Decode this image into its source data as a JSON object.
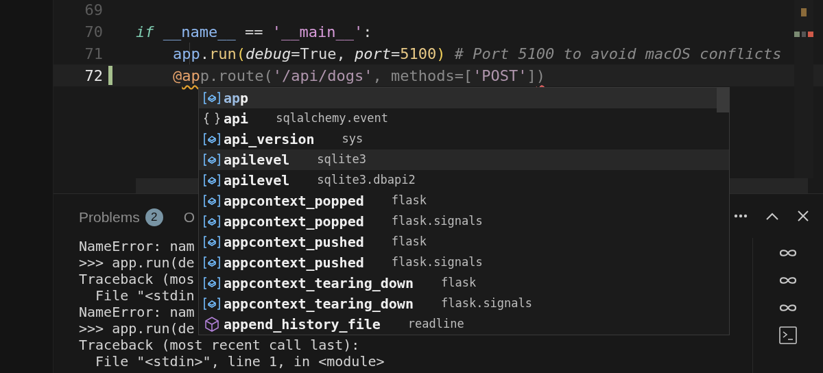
{
  "editor": {
    "lines": [
      {
        "number": "69",
        "current": false,
        "modified": false
      },
      {
        "number": "70",
        "current": false,
        "modified": false,
        "tokens": [
          {
            "text": "if ",
            "kind": "keyword"
          },
          {
            "text": "__name__",
            "kind": "variable"
          },
          {
            "text": " == ",
            "kind": "plain"
          },
          {
            "text": "'__main__'",
            "kind": "string"
          },
          {
            "text": ":",
            "kind": "plain"
          }
        ],
        "children": [
          {
            "number": "71",
            "current": false,
            "modified": false,
            "tokens": [
              {
                "text": "app",
                "kind": "variable"
              },
              {
                "text": ".",
                "kind": "plain"
              },
              {
                "text": "run",
                "kind": "function"
              },
              {
                "text": "(",
                "kind": "bracket"
              },
              {
                "text": "debug",
                "kind": "param"
              },
              {
                "text": "=True, ",
                "kind": "plain"
              },
              {
                "text": "port",
                "kind": "param"
              },
              {
                "text": "=",
                "kind": "plain"
              },
              {
                "text": "5100",
                "kind": "number"
              },
              {
                "text": ")",
                "kind": "bracket"
              },
              {
                "text": " # Port 5100 to avoid macOS conflicts",
                "kind": "comment"
              }
            ]
          },
          {
            "number": "72",
            "current": true,
            "modified": true,
            "tokens": [
              {
                "text": "@",
                "kind": "decorator"
              },
              {
                "text": "ap",
                "kind": "decorator",
                "warning": true
              },
              {
                "text": "p.route(",
                "kind": "ghost"
              },
              {
                "text": "'/api/dogs'",
                "kind": "ghost-string"
              },
              {
                "text": ", methods=[",
                "kind": "ghost"
              },
              {
                "text": "'POST'",
                "kind": "ghost-string"
              },
              {
                "text": "]",
                "kind": "ghost"
              },
              {
                "text": ")",
                "kind": "ghost",
                "error": true
              }
            ]
          }
        ]
      }
    ]
  },
  "suggestions": [
    {
      "match": "ap",
      "rest": "p",
      "kind": "variable",
      "selected": true,
      "hovered": false
    },
    {
      "match": "ap",
      "rest": "i",
      "detail": "sqlalchemy.event",
      "kind": "module",
      "selected": false,
      "hovered": false
    },
    {
      "match": "ap",
      "rest": "i_version",
      "detail": "sys",
      "kind": "variable",
      "selected": false,
      "hovered": false
    },
    {
      "match": "ap",
      "rest": "ilevel",
      "detail": "sqlite3",
      "kind": "variable",
      "selected": false,
      "hovered": true
    },
    {
      "match": "ap",
      "rest": "ilevel",
      "detail": "sqlite3.dbapi2",
      "kind": "variable",
      "selected": false,
      "hovered": false
    },
    {
      "match": "ap",
      "rest": "pcontext_popped",
      "detail": "flask",
      "kind": "variable",
      "selected": false,
      "hovered": false
    },
    {
      "match": "ap",
      "rest": "pcontext_popped",
      "detail": "flask.signals",
      "kind": "variable",
      "selected": false,
      "hovered": false
    },
    {
      "match": "ap",
      "rest": "pcontext_pushed",
      "detail": "flask",
      "kind": "variable",
      "selected": false,
      "hovered": false
    },
    {
      "match": "ap",
      "rest": "pcontext_pushed",
      "detail": "flask.signals",
      "kind": "variable",
      "selected": false,
      "hovered": false
    },
    {
      "match": "ap",
      "rest": "pcontext_tearing_down",
      "detail": "flask",
      "kind": "variable",
      "selected": false,
      "hovered": false
    },
    {
      "match": "ap",
      "rest": "pcontext_tearing_down",
      "detail": "flask.signals",
      "kind": "variable",
      "selected": false,
      "hovered": false
    },
    {
      "match": "ap",
      "rest": "pend_history_file",
      "detail": "readline",
      "kind": "class",
      "selected": false,
      "hovered": false
    }
  ],
  "panel": {
    "tabs": [
      {
        "label": "Problems",
        "badge": "2",
        "selected": false
      },
      {
        "label": "O",
        "selected": false
      }
    ],
    "terminal_lines": [
      "NameError: nam",
      ">>> app.run(de",
      "Traceback (mos",
      "  File \"<stdin",
      "NameError: nam",
      ">>> app.run(de",
      "Traceback (most recent call last):",
      "  File \"<stdin>\", line 1, in <module>"
    ],
    "terminal_list": [
      {
        "kind": "python"
      },
      {
        "kind": "python"
      },
      {
        "kind": "python"
      },
      {
        "kind": "shell"
      }
    ]
  }
}
